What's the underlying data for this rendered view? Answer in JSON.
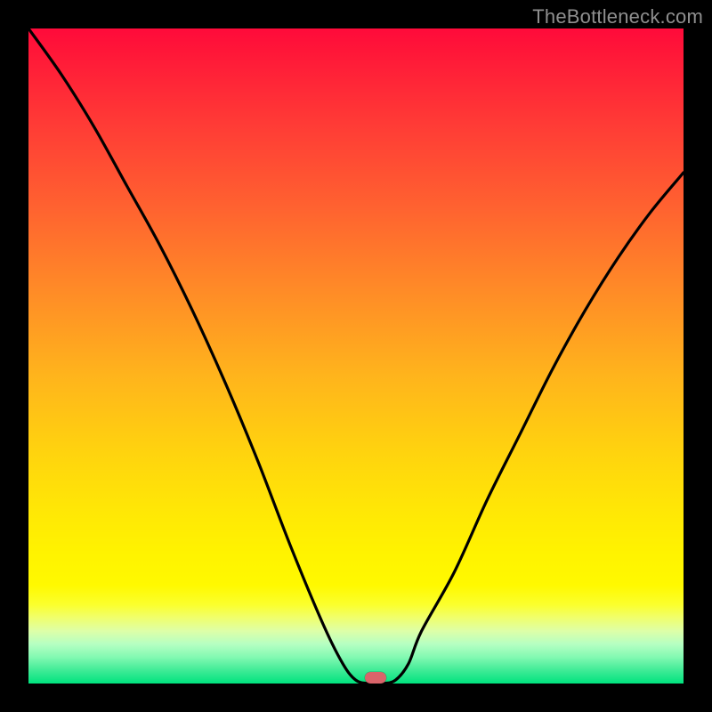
{
  "watermark": {
    "text": "TheBottleneck.com"
  },
  "marker": {
    "x_pct": 53,
    "y_pct": 99
  },
  "colors": {
    "frame": "#000000",
    "curve": "#000000",
    "marker": "#d9646a",
    "watermark": "#8f8f8f",
    "gradient_top": "#ff0a3a",
    "gradient_bottom": "#00e37e"
  },
  "chart_data": {
    "type": "line",
    "title": "",
    "xlabel": "",
    "ylabel": "",
    "xlim": [
      0,
      100
    ],
    "ylim": [
      0,
      100
    ],
    "grid": false,
    "legend": false,
    "series": [
      {
        "name": "bottleneck-curve",
        "x": [
          0,
          5,
          10,
          15,
          20,
          25,
          30,
          35,
          40,
          45,
          48,
          50,
          52,
          54,
          56,
          58,
          60,
          65,
          70,
          75,
          80,
          85,
          90,
          95,
          100
        ],
        "values": [
          100,
          93,
          85,
          76,
          67,
          57,
          46,
          34,
          21,
          9,
          3,
          0.5,
          0,
          0,
          0.5,
          3,
          8,
          17,
          28,
          38,
          48,
          57,
          65,
          72,
          78
        ]
      }
    ],
    "marker_point": {
      "x": 53,
      "y": 0
    },
    "background": "vertical-rainbow-gradient",
    "notes": "V-shaped curve with minimum around x≈52–54; left branch reaches 100 at x=0; right branch reaches ~78 at x=100."
  }
}
